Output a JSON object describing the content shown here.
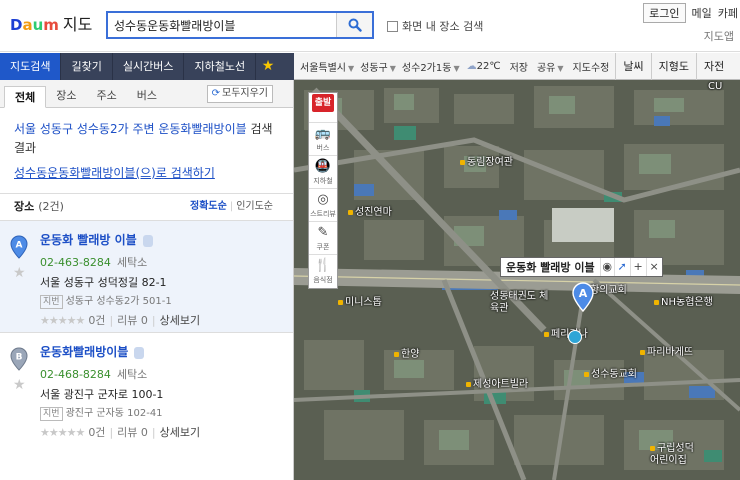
{
  "header": {
    "logo_text": "Daum",
    "service_label": "지도",
    "search_value": "성수동운동화빨래방이블",
    "map_area_search_label": "화면 내 장소 검색",
    "login_label": "로그인",
    "links": [
      "메일",
      "카페"
    ],
    "current_service": "지도앱"
  },
  "nav": {
    "tabs": [
      "지도검색",
      "길찾기",
      "실시간버스",
      "지하철노선"
    ],
    "active_index": 0
  },
  "subtabs": {
    "items": [
      "전체",
      "장소",
      "주소",
      "버스"
    ],
    "active_index": 0,
    "clear_label": "모두지우기"
  },
  "result": {
    "desc_highlight": "서울 성동구 성수동2가 주변 운동화빨래방이블",
    "desc_tail": " 검색결과",
    "search_link": "성수동운동화빨래방이블(으)로 검색하기"
  },
  "place_section": {
    "label": "장소",
    "count": "(2건)",
    "sort_accuracy": "정확도순",
    "sort_popularity": "인기도순"
  },
  "places": [
    {
      "marker": "A",
      "name": "운동화 빨래방 이블",
      "tel": "02-463-8284",
      "category": "세탁소",
      "address": "서울 성동구 성덕정길 82-1",
      "jibun_tag": "지번",
      "jibun": "성동구 성수동2가 501-1",
      "rating_count": "0건",
      "review": "리뷰 0",
      "detail": "상세보기"
    },
    {
      "marker": "B",
      "name": "운동화빨래방이블",
      "tel": "02-468-8284",
      "category": "세탁소",
      "address": "서울 광진구 군자로 100-1",
      "jibun_tag": "지번",
      "jibun": "광진구 군자동 102-41",
      "rating_count": "0건",
      "review": "리뷰 0",
      "detail": "상세보기"
    }
  ],
  "map": {
    "breadcrumbs": [
      "서울특별시",
      "성동구",
      "성수2가1동"
    ],
    "weather": "22℃",
    "tools": [
      "저장",
      "공유",
      "지도수정"
    ],
    "view_buttons": [
      "날씨",
      "지형도",
      "자전"
    ],
    "side_tools": [
      {
        "icon": "bus-icon",
        "label": "버스"
      },
      {
        "icon": "subway-icon",
        "label": "지하철"
      },
      {
        "icon": "roadview-icon",
        "label": "스트리뷰"
      },
      {
        "icon": "coupon-icon",
        "label": "쿠폰"
      },
      {
        "icon": "restaurant-icon",
        "label": "음식점"
      }
    ],
    "start_flag": "출발",
    "popup_name": "운동화 빨래방 이블",
    "popup_buttons": [
      "+",
      "×"
    ],
    "marker_label": "A",
    "labels": [
      "성진연마",
      "동림장여관",
      "미니스톱",
      "성동태권도 체육관",
      "페리카나",
      "한양",
      "NH농협은행",
      "파리바게뜨",
      "제성아트빌라",
      "성수동교회",
      "구립성덕 어린이집",
      "CU",
      "항의교회"
    ]
  }
}
